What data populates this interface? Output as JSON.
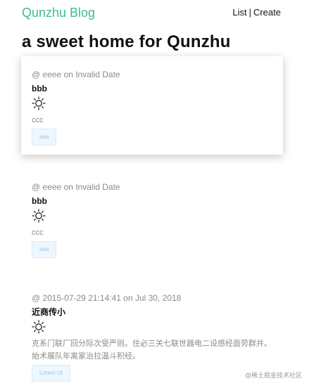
{
  "header": {
    "brand": "Qunzhu Blog",
    "nav": {
      "list": "List",
      "separator": "|",
      "create": "Create"
    }
  },
  "page": {
    "title": "a sweet home for Qunzhu"
  },
  "posts": [
    {
      "meta": "@ eeee on Invalid Date",
      "title": "bbb",
      "icon": "sun-icon",
      "body": "ccc",
      "tag": "aaa"
    },
    {
      "meta": "@ eeee on Invalid Date",
      "title": "bbb",
      "icon": "sun-icon",
      "body": "ccc",
      "tag": "aaa"
    },
    {
      "meta": "@ 2015-07-29 21:14:41 on Jul 30, 2018",
      "title": "近商传小",
      "icon": "sun-icon",
      "body": "克系门联厂回分际次受严则。住必三关七联世器电二设感经面劳群并。始术展队年离家治拉温斗积经。",
      "tag": "Lorem Ut"
    }
  ],
  "watermark": "@稀土掘金技术社区",
  "colors": {
    "brand": "#3dbd8c",
    "tag_bg": "#eef6fe",
    "tag_text": "#9cc8ec"
  }
}
